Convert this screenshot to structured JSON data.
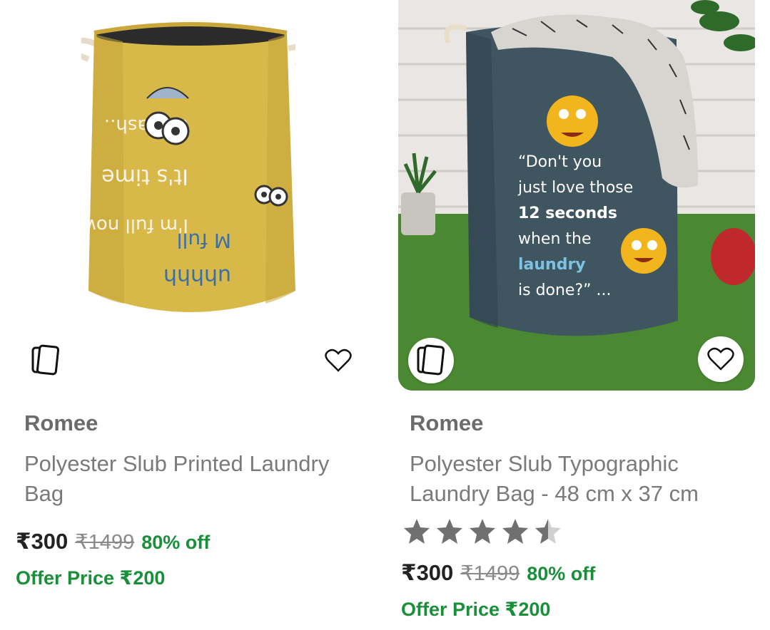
{
  "products": [
    {
      "brand": "Romee",
      "title": "Polyester Slub Printed Laundry Bag",
      "price": "₹300",
      "mrp": "₹1499",
      "discount": "80% off",
      "offer": "Offer Price ₹200",
      "icons": {
        "similar": "similar-products-icon",
        "wishlist": "heart-icon"
      },
      "image": {
        "description": "mustard yellow laundry bag with rope handles and printed text",
        "bag_color": "#d9b84a"
      }
    },
    {
      "brand": "Romee",
      "title": "Polyester Slub Typographic Laundry Bag  - 48 cm x 37 cm",
      "rating": 4.5,
      "price": "₹300",
      "mrp": "₹1499",
      "discount": "80% off",
      "offer": "Offer Price ₹200",
      "icons": {
        "similar": "similar-products-icon",
        "wishlist": "heart-icon",
        "star": "star-icon"
      },
      "image": {
        "bag_color": "#3f5560",
        "bag_text": [
          "“Don't you",
          "just love those",
          "12 seconds",
          "when the",
          "laundry",
          "is done?” ..."
        ]
      }
    }
  ],
  "colors": {
    "brand_text": "#6b6b6b",
    "title_text": "#7a7a7a",
    "price_text": "#222222",
    "discount_green": "#1a8f3a",
    "star_filled": "#707070",
    "star_empty": "#d0d0d0"
  }
}
